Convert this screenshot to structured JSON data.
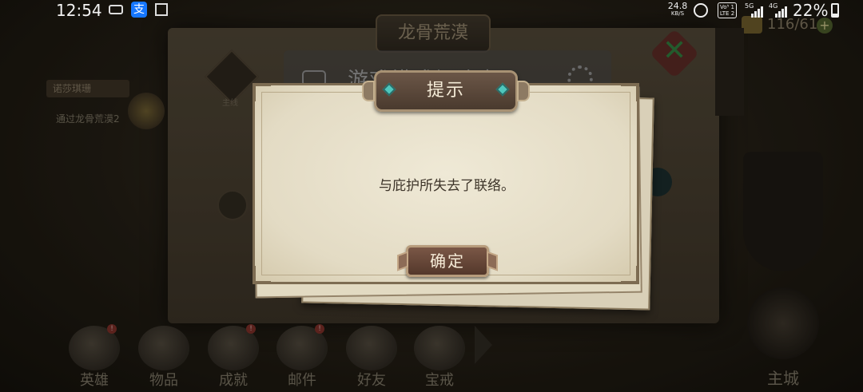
{
  "status_bar": {
    "time": "12:54",
    "net_speed": "24.8",
    "net_speed_unit": "KB/S",
    "volte_line1": "Vo⁵ 1",
    "volte_line2": "LTE 2",
    "signal1_label": "5G",
    "signal2_label": "4G",
    "battery_percent": "22%",
    "battery_level": 0.22,
    "alipay_glyph": "支"
  },
  "background": {
    "map_title": "龙骨荒漠",
    "speed_banner": "游戏模式加速中",
    "counter": "116/61",
    "counter_plus": "+",
    "close_glyph": "✕",
    "quest_tag": "诺莎琪珊",
    "quest_desc": "通过龙骨荒漠2",
    "emblem_label": "主线"
  },
  "bottom_nav": {
    "items": [
      {
        "label": "英雄",
        "alert": "!"
      },
      {
        "label": "物品",
        "alert": ""
      },
      {
        "label": "成就",
        "alert": "!"
      },
      {
        "label": "邮件",
        "alert": "!"
      },
      {
        "label": "好友",
        "alert": ""
      },
      {
        "label": "宝戒",
        "alert": ""
      }
    ],
    "main_city": "主城"
  },
  "dialog": {
    "title": "提示",
    "message": "与庇护所失去了联络。",
    "confirm_label": "确定"
  },
  "colors": {
    "paper": "#e8e0c9",
    "plaque": "#5a4638",
    "gem": "#4fc7bd"
  }
}
